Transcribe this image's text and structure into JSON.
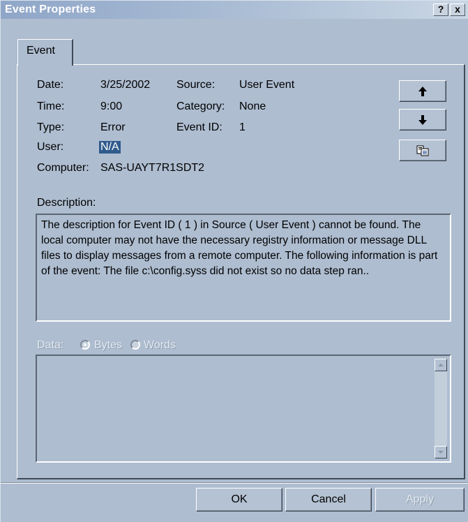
{
  "window": {
    "title": "Event Properties",
    "help_label": "?",
    "close_label": "x"
  },
  "tabs": [
    {
      "label": "Event"
    }
  ],
  "event": {
    "date_label": "Date:",
    "date_value": "3/25/2002",
    "time_label": "Time:",
    "time_value": "9:00",
    "type_label": "Type:",
    "type_value": "Error",
    "user_label": "User:",
    "user_value": "N/A",
    "computer_label": "Computer:",
    "computer_value": "SAS-UAYT7R1SDT2",
    "source_label": "Source:",
    "source_value": "User Event",
    "category_label": "Category:",
    "category_value": "None",
    "event_id_label": "Event ID:",
    "event_id_value": "1"
  },
  "nav_buttons": {
    "up_icon": "arrow-up-icon",
    "down_icon": "arrow-down-icon",
    "copy_icon": "copy-icon"
  },
  "description": {
    "label": "Description:",
    "text": "The description for Event ID ( 1 ) in Source ( User Event ) cannot be found. The local computer may not have the necessary registry information or message DLL files to display messages from a remote computer. The following information is part of the event: The file c:\\config.syss did not exist so no data step ran.."
  },
  "data_section": {
    "label": "Data:",
    "bytes_label": "Bytes",
    "words_label": "Words",
    "selected": "Bytes"
  },
  "footer": {
    "ok_label": "OK",
    "cancel_label": "Cancel",
    "apply_label": "Apply"
  },
  "colors": {
    "dialog_bg": "#aebdd0",
    "title_bar": "#8fa6c8",
    "selection": "#2f5a8c"
  }
}
